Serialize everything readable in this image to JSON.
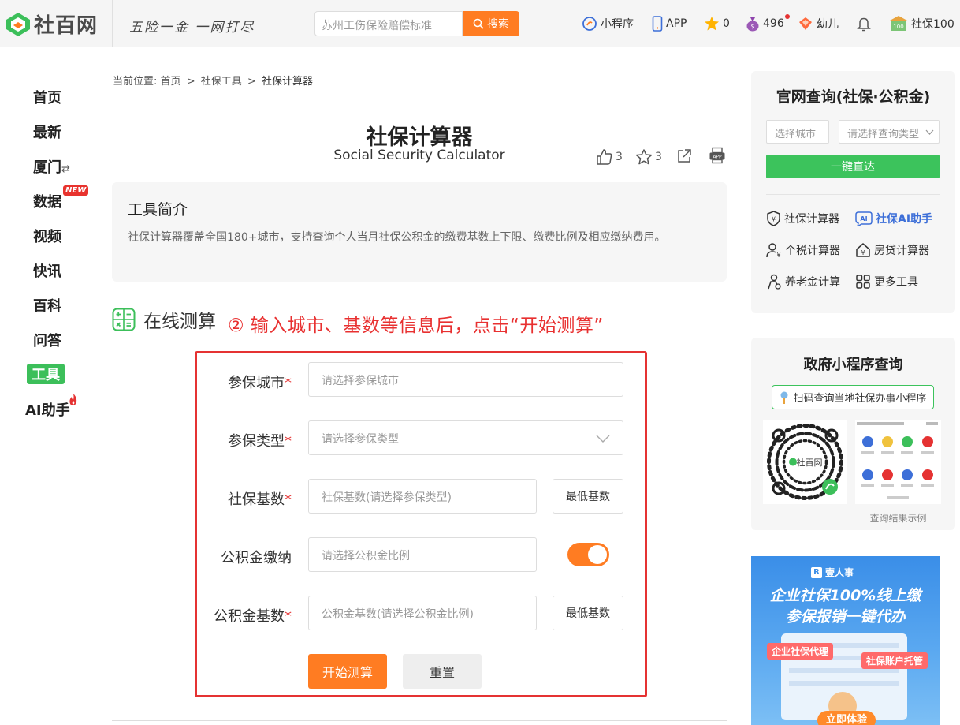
{
  "header": {
    "logo_text": "社百网",
    "slogan": "五险一金 一网打尽",
    "search_placeholder": "苏州工伤保险赔偿标准",
    "search_button": "搜索",
    "items": {
      "mini_program": "小程序",
      "app": "APP",
      "stars": "0",
      "coins": "496",
      "kid": "幼儿",
      "user": "社保100"
    }
  },
  "leftnav": {
    "items": [
      "首页",
      "最新",
      "厦门",
      "数据",
      "视频",
      "快讯",
      "百科",
      "问答",
      "工具",
      "AI助手"
    ],
    "new_badge": "NEW",
    "city_switch_icon": "⇄"
  },
  "breadcrumb": {
    "prefix": "当前位置:",
    "home": "首页",
    "sep": ">",
    "tools": "社保工具",
    "current": "社保计算器"
  },
  "page": {
    "title": "社保计算器",
    "subtitle": "Social Security Calculator",
    "likes": "3",
    "favorites": "3"
  },
  "intro": {
    "title": "工具简介",
    "text": "社保计算器覆盖全国180+城市，支持查询个人当月社保公积金的缴费基数上下限、缴费比例及相应缴纳费用。"
  },
  "section": {
    "title": "在线测算",
    "annotation": "② 输入城市、基数等信息后，点击“开始测算”"
  },
  "form": {
    "city_label": "参保城市",
    "city_placeholder": "请选择参保城市",
    "type_label": "参保类型",
    "type_placeholder": "请选择参保类型",
    "base_label": "社保基数",
    "base_placeholder": "社保基数(请选择参保类型)",
    "base_min_button": "最低基数",
    "fund_label": "公积金缴纳",
    "fund_placeholder": "请选择公积金比例",
    "fund_enabled": true,
    "fund_base_label": "公积金基数",
    "fund_base_placeholder": "公积金基数(请选择公积金比例)",
    "fund_base_min_button": "最低基数",
    "required_mark": "*",
    "start_button": "开始测算",
    "reset_button": "重置"
  },
  "right": {
    "official": {
      "title": "官网查询(社保·公积金)",
      "city_select": "选择城市",
      "type_select": "请选择查询类型",
      "go_button": "一键直达"
    },
    "tools": [
      {
        "label": "社保计算器",
        "icon": "shield-icon"
      },
      {
        "label": "社保AI助手",
        "icon": "ai-icon"
      },
      {
        "label": "个税计算器",
        "icon": "person-tax-icon"
      },
      {
        "label": "房贷计算器",
        "icon": "house-icon"
      },
      {
        "label": "养老金计算",
        "icon": "pension-icon"
      },
      {
        "label": "更多工具",
        "icon": "grid-icon"
      }
    ],
    "gov": {
      "title": "政府小程序查询",
      "scan_tip": "扫码查询当地社保办事小程序",
      "qr_brand": "社百网",
      "example_caption": "查询结果示例"
    },
    "ad": {
      "brand": "壹人事",
      "line1": "企业社保100%线上缴",
      "line2": "参保报销一键代办",
      "tag1": "企业社保代理",
      "tag2": "社保账户托管",
      "cta": "立即体验"
    }
  },
  "colors": {
    "accent": "#ff7c22",
    "green": "#3cc35c",
    "red": "#e53232",
    "ai_blue": "#3d6fd8"
  }
}
